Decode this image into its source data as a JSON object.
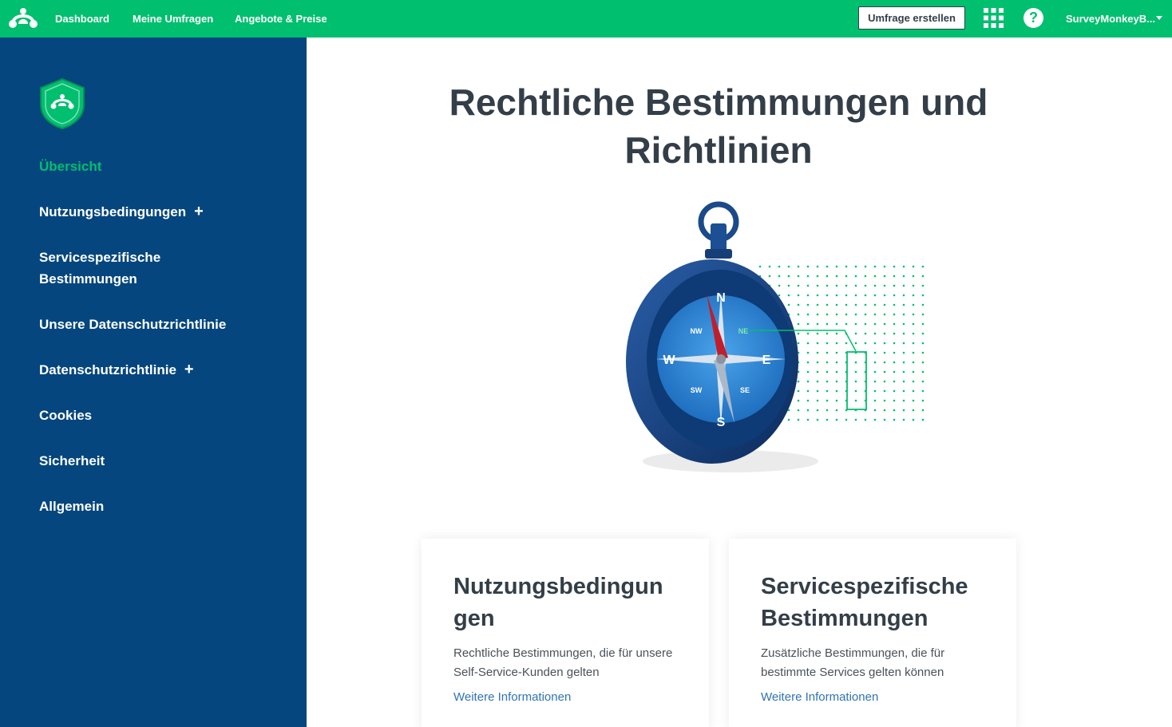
{
  "topbar": {
    "nav": [
      "Dashboard",
      "Meine Umfragen",
      "Angebote & Preise"
    ],
    "create_button": "Umfrage erstellen",
    "help": "?",
    "account": "SurveyMonkeyB..."
  },
  "sidebar": {
    "items": [
      {
        "label": "Übersicht",
        "active": true,
        "expandable": false
      },
      {
        "label": "Nutzungsbedingungen",
        "active": false,
        "expandable": true
      },
      {
        "label": "Servicespezifische Bestimmungen",
        "active": false,
        "expandable": false
      },
      {
        "label": "Unsere Datenschutzrichtlinie",
        "active": false,
        "expandable": false
      },
      {
        "label": "Datenschutzrichtlinie",
        "active": false,
        "expandable": true
      },
      {
        "label": "Cookies",
        "active": false,
        "expandable": false
      },
      {
        "label": "Sicherheit",
        "active": false,
        "expandable": false
      },
      {
        "label": "Allgemein",
        "active": false,
        "expandable": false
      }
    ],
    "plus": "+"
  },
  "main": {
    "title": "Rechtliche Bestimmungen und Richtlinien",
    "compass": {
      "n": "N",
      "e": "E",
      "s": "S",
      "w": "W",
      "nw": "NW",
      "ne": "NE",
      "sw": "SW",
      "se": "SE"
    },
    "cards": [
      {
        "title": "Nutzungsbedingungen",
        "text": "Rechtliche Bestimmungen, die für unsere Self-Service-Kunden gelten",
        "link": "Weitere Informationen"
      },
      {
        "title": "Servicespezifische Bestimmungen",
        "text": "Zusätzliche Bestimmungen, die für bestimmte Services gelten können",
        "link": "Weitere Informationen"
      }
    ]
  },
  "colors": {
    "brand_green": "#00bf6f",
    "sidebar_blue": "#05467e",
    "link_blue": "#2f74b5",
    "text_dark": "#333e48"
  }
}
